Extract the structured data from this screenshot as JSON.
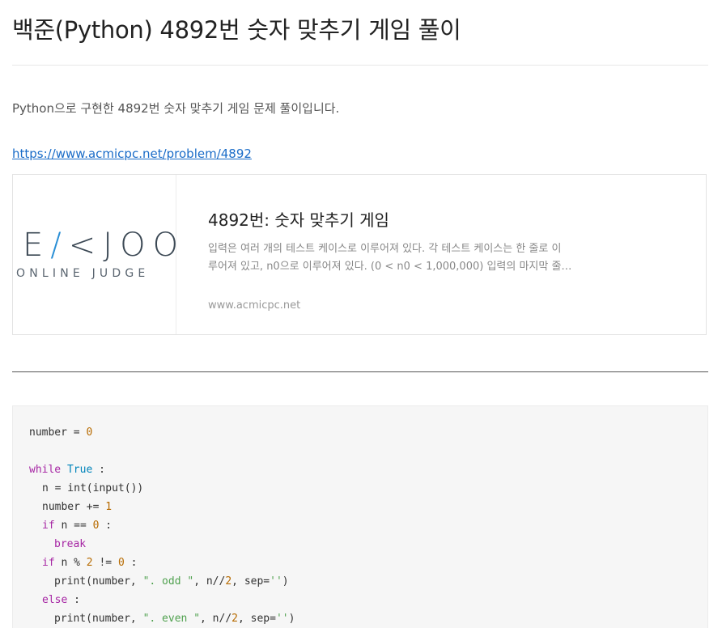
{
  "post": {
    "title": "백준(Python) 4892번 숫자 맞추기 게임 풀이",
    "intro": "Python으로 구현한 4892번 숫자 맞추기 게임 문제 풀이입니다.",
    "link": "https://www.acmicpc.net/problem/4892"
  },
  "og_card": {
    "logo_main_prefix": "E",
    "logo_main_accent": "/",
    "logo_main_k": "<",
    "logo_main_suffix": "JOO",
    "logo_sub": "ONLINE JUDGE",
    "title": "4892번: 숫자 맞추기 게임",
    "desc_line1": "입력은 여러 개의 테스트 케이스로 이루어져 있다. 각 테스트 케이스는 한 줄로 이",
    "desc_line2": "루어져 있고, n0으로 이루어져 있다. (0 < n0 < 1,000,000) 입력의 마지막 줄…",
    "domain": "www.acmicpc.net"
  },
  "code": {
    "l1_a": "number = ",
    "l1_num": "0",
    "l3_kw": "while",
    "l3_true": "True",
    "l3_colon": " :",
    "l4": "n = int(input())",
    "l5_a": "number += ",
    "l5_num": "1",
    "l6_kw": "if",
    "l6_a": " n == ",
    "l6_num": "0",
    "l6_colon": " :",
    "l7_kw": "break",
    "l8_kw": "if",
    "l8_a": " n % ",
    "l8_num2": "2",
    "l8_b": " != ",
    "l8_num0": "0",
    "l8_colon": " :",
    "l9_a": "print(number, ",
    "l9_str": "\". odd \"",
    "l9_b": ", n//",
    "l9_num": "2",
    "l9_c": ", sep=",
    "l9_sep": "''",
    "l9_d": ")",
    "l10_kw": "else",
    "l10_colon": " :",
    "l11_a": "print(number, ",
    "l11_str": "\". even \"",
    "l11_b": ", n//",
    "l11_num": "2",
    "l11_c": ", sep=",
    "l11_sep": "''",
    "l11_d": ")"
  },
  "colors": {
    "link": "#1a6cc8",
    "logo_accent": "#2a8fd6",
    "keyword": "#a626a4",
    "number": "#b76b01",
    "string": "#50a14f"
  }
}
